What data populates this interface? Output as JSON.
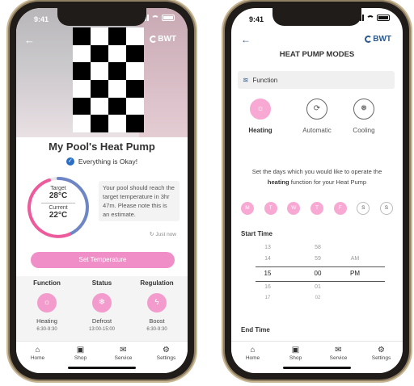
{
  "left_phone": {
    "status": {
      "time": "9:41"
    },
    "brand": "BWT",
    "pool_title": "My Pool's Heat Pump",
    "status_message": "Everything is Okay!",
    "gauge": {
      "target_label": "Target",
      "target_value": "28°C",
      "current_label": "Current",
      "current_value": "22°C"
    },
    "info_text": "Your pool should reach the target temperature in 3hr 47m. Please note this is an estimate.",
    "updated": "Just now",
    "set_temperature_label": "Set Temperature",
    "panel": {
      "function": {
        "header": "Function",
        "value": "Heating",
        "sub": "6:30-9:30",
        "icon": "sun-icon"
      },
      "status": {
        "header": "Status",
        "value": "Defrost",
        "sub": "13:00-15:00",
        "icon": "snowflake-icon"
      },
      "regulation": {
        "header": "Regulation",
        "value": "Boost",
        "sub": "6:30-9:30",
        "icon": "bolt-icon"
      }
    },
    "tabs": [
      "Home",
      "Shop",
      "Service",
      "Settings"
    ]
  },
  "right_phone": {
    "status": {
      "time": "9:41"
    },
    "brand": "BWT",
    "title": "HEAT PUMP MODES",
    "function_label": "Function",
    "modes": [
      {
        "label": "Heating",
        "active": true,
        "icon": "sun-icon"
      },
      {
        "label": "Automatic",
        "active": false,
        "icon": "auto-icon"
      },
      {
        "label": "Cooling",
        "active": false,
        "icon": "cooling-icon"
      }
    ],
    "days_text_before": "Set the days which you would like to operate the",
    "days_text_bold": "heating",
    "days_text_after": "function for your Heat Pump",
    "days": [
      {
        "label": "M",
        "on": true
      },
      {
        "label": "T",
        "on": true
      },
      {
        "label": "W",
        "on": true
      },
      {
        "label": "T",
        "on": true
      },
      {
        "label": "F",
        "on": true
      },
      {
        "label": "S",
        "on": false
      },
      {
        "label": "S",
        "on": false
      }
    ],
    "start_time_label": "Start Time",
    "picker": {
      "hours": [
        "13",
        "14",
        "15",
        "16",
        "17"
      ],
      "minutes": [
        "58",
        "59",
        "00",
        "01",
        "02"
      ],
      "ampm": [
        "",
        "AM",
        "PM",
        "",
        ""
      ]
    },
    "end_time_label": "End Time",
    "tabs": [
      "Home",
      "Shop",
      "Service",
      "Settings"
    ]
  },
  "colors": {
    "accent_pink": "#f08ec8",
    "brand_blue": "#2e5a8c",
    "check_blue": "#2a6fc4"
  }
}
